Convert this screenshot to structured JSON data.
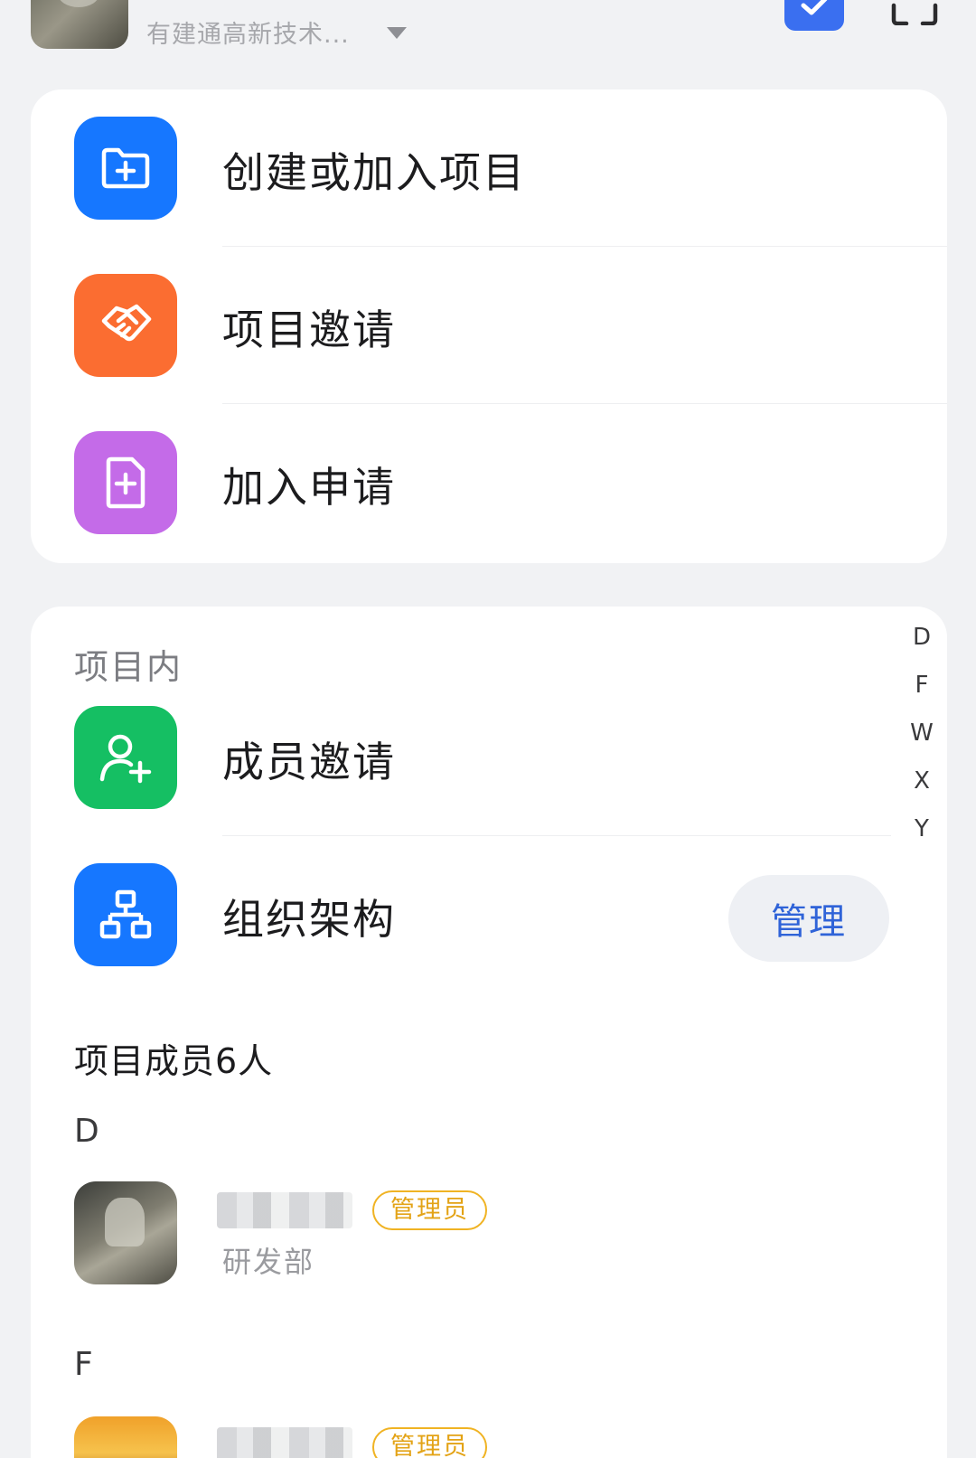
{
  "header": {
    "org_name": "有建通高新技术...",
    "icons": [
      "dropdown-caret-icon",
      "check-icon",
      "scan-icon"
    ]
  },
  "actions": {
    "items": [
      {
        "label": "创建或加入项目",
        "icon": "folder-plus-icon",
        "color": "#1677ff"
      },
      {
        "label": "项目邀请",
        "icon": "handshake-icon",
        "color": "#fb6d31"
      },
      {
        "label": "加入申请",
        "icon": "file-plus-icon",
        "color": "#c46be8"
      }
    ]
  },
  "project": {
    "section_title": "项目内",
    "member_invite_label": "成员邀请",
    "org_structure_label": "组织架构",
    "manage_label": "管理",
    "member_count_label": "项目成员6人",
    "groups": [
      {
        "letter": "D",
        "members": [
          {
            "badge": "管理员",
            "dept": "研发部"
          }
        ]
      },
      {
        "letter": "F",
        "members": [
          {
            "badge": "管理员",
            "dept": ""
          }
        ]
      }
    ]
  },
  "alpha_index": [
    "D",
    "F",
    "W",
    "X",
    "Y"
  ],
  "colors": {
    "accent_blue": "#2f63d8",
    "admin_badge": "#e3a316",
    "background": "#f1f2f4"
  }
}
